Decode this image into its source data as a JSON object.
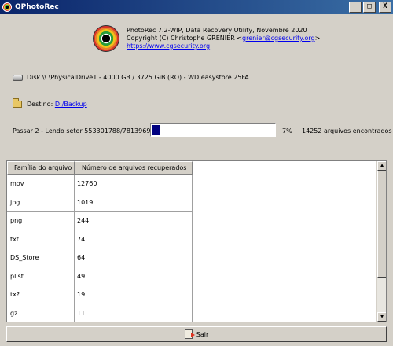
{
  "window": {
    "title": "QPhotoRec",
    "minimize_label": "_",
    "maximize_label": "□",
    "close_label": "X"
  },
  "header": {
    "line1": "PhotoRec 7.2-WIP, Data Recovery Utility, Novembre 2020",
    "copyright_prefix": "Copyright (C) Christophe GRENIER <",
    "email": "grenier@cgsecurity.org",
    "copyright_suffix": ">",
    "website": "https://www.cgsecurity.org"
  },
  "disk": {
    "label": "Disk \\\\.\\PhysicalDrive1 - 4000 GB / 3725 GiB (RO) - WD easystore 25FA"
  },
  "destination": {
    "label": "Destino:",
    "path": "D:/Backup"
  },
  "progress": {
    "status": "Passar 2 - Lendo setor 553301788/7813969920",
    "percent_label": "7%",
    "fraction": 0.07,
    "files_found": "14252 arquivos encontrados"
  },
  "table": {
    "headers": [
      "Família do arquivo",
      "Número de arquivos recuperados"
    ],
    "rows": [
      [
        "mov",
        "12760"
      ],
      [
        "jpg",
        "1019"
      ],
      [
        "png",
        "244"
      ],
      [
        "txt",
        "74"
      ],
      [
        "DS_Store",
        "64"
      ],
      [
        "plist",
        "49"
      ],
      [
        "tx?",
        "19"
      ],
      [
        "gz",
        "11"
      ]
    ]
  },
  "footer": {
    "quit_label": "Sair"
  }
}
